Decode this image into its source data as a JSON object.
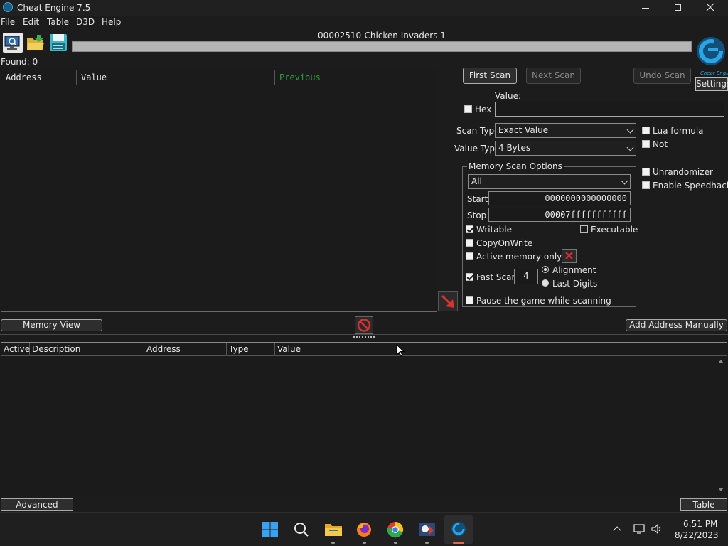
{
  "window": {
    "title": "Cheat Engine 7.5"
  },
  "menu": [
    "File",
    "Edit",
    "Table",
    "D3D",
    "Help"
  ],
  "process": {
    "name": "00002510-Chicken Invaders 1"
  },
  "found": "Found: 0",
  "results_columns": [
    "Address",
    "Value",
    "Previous"
  ],
  "scan": {
    "first_scan": "First Scan",
    "next_scan": "Next Scan",
    "undo_scan": "Undo Scan",
    "settings": "Settings",
    "value_label": "Value:",
    "hex_label": "Hex",
    "value_input": "",
    "scan_type_label": "Scan Type",
    "scan_type": "Exact Value",
    "value_type_label": "Value Type",
    "value_type": "4 Bytes",
    "lua_formula": "Lua formula",
    "not": "Not",
    "unrandomizer": "Unrandomizer",
    "enable_speedhack": "Enable Speedhack"
  },
  "memory_options": {
    "legend": "Memory Scan Options",
    "region": "All",
    "start_label": "Start",
    "start": "0000000000000000",
    "stop_label": "Stop",
    "stop": "00007fffffffffff",
    "writable": "Writable",
    "executable": "Executable",
    "copy_on_write": "CopyOnWrite",
    "active_memory_only": "Active memory only",
    "fast_scan": "Fast Scan",
    "fast_scan_value": "4",
    "alignment": "Alignment",
    "last_digits": "Last Digits",
    "pause_game": "Pause the game while scanning"
  },
  "bottom": {
    "memory_view": "Memory View",
    "add_address": "Add Address Manually",
    "columns": [
      "Active",
      "Description",
      "Address",
      "Type",
      "Value"
    ],
    "advanced_options": "Advanced Options",
    "table_extras": "Table Extras"
  },
  "taskbar": {
    "time": "6:51 PM",
    "date": "8/22/2023"
  },
  "colors": {
    "accent": "#1e8fd6",
    "previous_col": "#2f9e3a"
  }
}
